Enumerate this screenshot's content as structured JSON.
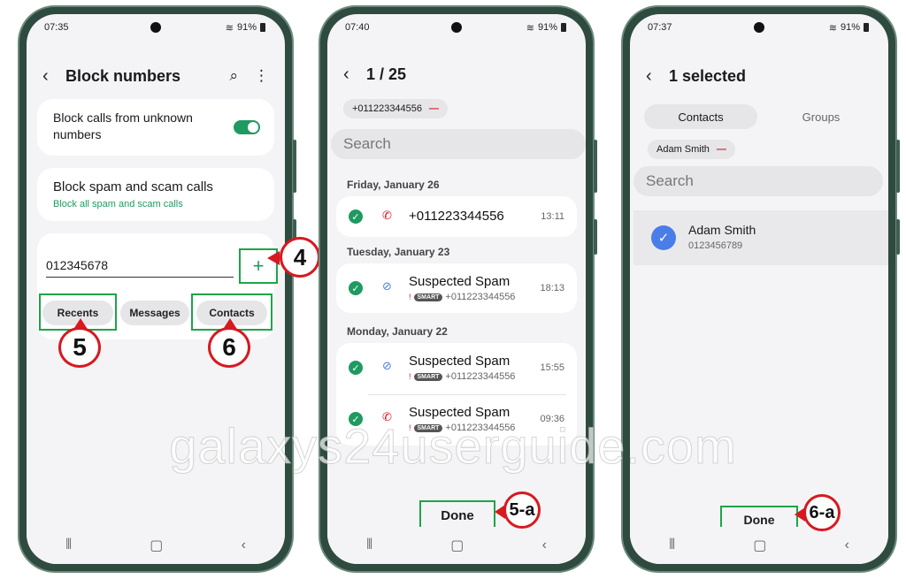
{
  "phone1": {
    "status": {
      "time": "07:35",
      "battery": "91%"
    },
    "title": "Block numbers",
    "unknown_label": "Block calls from unknown numbers",
    "spam_title": "Block spam and scam calls",
    "spam_sub": "Block all spam and scam calls",
    "number_value": "012345678",
    "add_icon": "+",
    "chips": {
      "recents": "Recents",
      "messages": "Messages",
      "contacts": "Contacts"
    },
    "callouts": {
      "c4": "4",
      "c5": "5",
      "c6": "6"
    }
  },
  "phone2": {
    "status": {
      "time": "07:40",
      "battery": "91%"
    },
    "title": "1 / 25",
    "selected_chip": "+011223344556",
    "search_placeholder": "Search",
    "sections": [
      {
        "date": "Friday, January 26"
      },
      {
        "date": "Tuesday, January 23"
      },
      {
        "date": "Monday, January 22"
      }
    ],
    "rows": [
      {
        "title": "+011223344556",
        "sub": "",
        "time": "13:11"
      },
      {
        "title": "Suspected Spam",
        "sub": "+011223344556",
        "time": "18:13"
      },
      {
        "title": "Suspected Spam",
        "sub": "+011223344556",
        "time": "15:55"
      },
      {
        "title": "Suspected Spam",
        "sub": "+011223344556",
        "time": "09:36"
      }
    ],
    "smart_label": "SMART",
    "done_label": "Done",
    "callout": "5-a"
  },
  "phone3": {
    "status": {
      "time": "07:37",
      "battery": "91%"
    },
    "title": "1 selected",
    "tabs": {
      "contacts": "Contacts",
      "groups": "Groups"
    },
    "selected_chip": "Adam Smith",
    "search_placeholder": "Search",
    "contact": {
      "name": "Adam Smith",
      "number": "0123456789"
    },
    "done_label": "Done",
    "callout": "6-a"
  },
  "watermark": "galaxys24userguide.com",
  "colors": {
    "accent_green": "#1f9a61",
    "highlight_box": "#1fa34a",
    "callout_red": "#d71920",
    "select_blue": "#4a7de8"
  }
}
